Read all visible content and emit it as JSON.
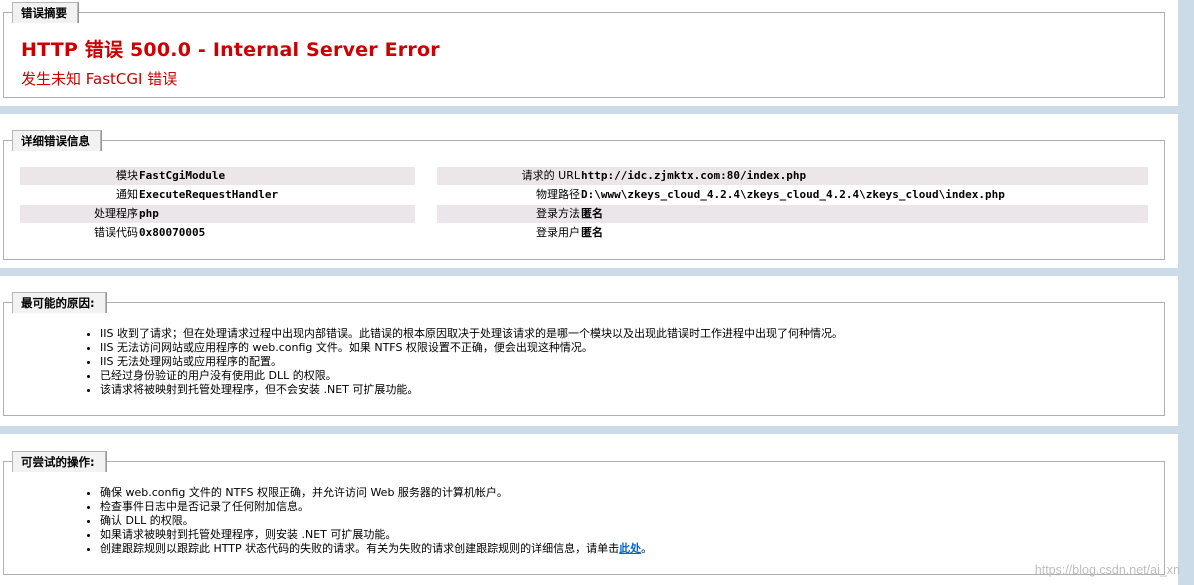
{
  "summary": {
    "legend": "错误摘要",
    "title": "HTTP 错误 500.0 - Internal Server Error",
    "subtitle": "发生未知 FastCGI 错误"
  },
  "details": {
    "legend": "详细错误信息",
    "left": [
      {
        "label": "模块",
        "value": "FastCgiModule"
      },
      {
        "label": "通知",
        "value": "ExecuteRequestHandler"
      },
      {
        "label": "处理程序",
        "value": "php"
      },
      {
        "label": "错误代码",
        "value": "0x80070005"
      }
    ],
    "right": [
      {
        "label": "请求的 URL",
        "value": "http://idc.zjmktx.com:80/index.php"
      },
      {
        "label": "物理路径",
        "value": "D:\\www\\zkeys_cloud_4.2.4\\zkeys_cloud_4.2.4\\zkeys_cloud\\index.php"
      },
      {
        "label": "登录方法",
        "value": "匿名"
      },
      {
        "label": "登录用户",
        "value": "匿名"
      }
    ]
  },
  "causes": {
    "legend": "最可能的原因:",
    "items": [
      "IIS 收到了请求；但在处理请求过程中出现内部错误。此错误的根本原因取决于处理该请求的是哪一个模块以及出现此错误时工作进程中出现了何种情况。",
      "IIS 无法访问网站或应用程序的 web.config 文件。如果 NTFS 权限设置不正确，便会出现这种情况。",
      "IIS 无法处理网站或应用程序的配置。",
      "已经过身份验证的用户没有使用此 DLL 的权限。",
      "该请求将被映射到托管处理程序，但不会安装 .NET 可扩展功能。"
    ]
  },
  "actions": {
    "legend": "可尝试的操作:",
    "items": [
      "确保 web.config 文件的 NTFS 权限正确，并允许访问 Web 服务器的计算机帐户。",
      "检查事件日志中是否记录了任何附加信息。",
      "确认 DLL 的权限。",
      "如果请求被映射到托管处理程序，则安装 .NET 可扩展功能。"
    ],
    "last_item_prefix": "创建跟踪规则以跟踪此 HTTP 状态代码的失败的请求。有关为失败的请求创建跟踪规则的详细信息，请单击",
    "last_item_link": "此处",
    "last_item_suffix": "。"
  },
  "watermark": "https://blog.csdn.net/ai_xn"
}
